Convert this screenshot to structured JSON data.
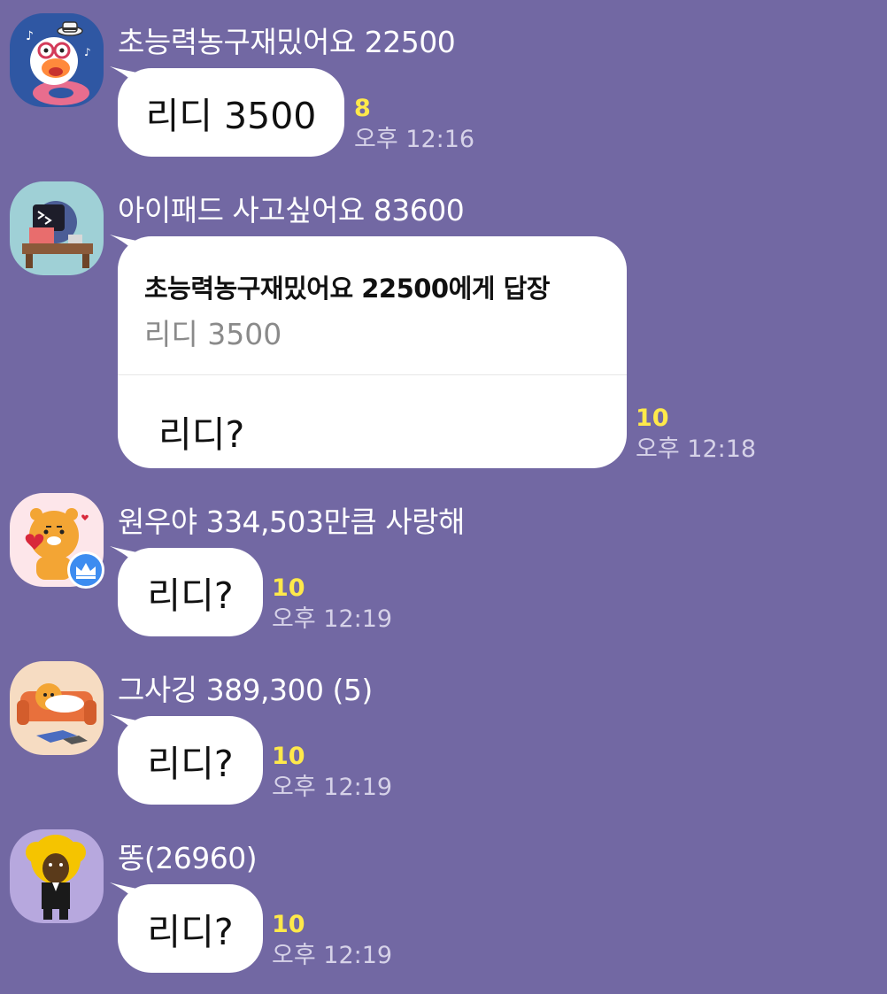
{
  "accent_colors": {
    "background": "#7268a3",
    "bubble": "#ffffff",
    "unread_count": "#ffe94a",
    "time": "#d6d2e8"
  },
  "messages": [
    {
      "sender": "초능력농구재밌어요 22500",
      "avatar_icon": "duck-character-icon",
      "text": "리디 3500",
      "unread": "8",
      "time": "오후 12:16"
    },
    {
      "sender": "아이패드 사고싶어요 83600",
      "avatar_icon": "bear-at-desk-character-icon",
      "reply": {
        "title": "초능력농구재밌어요 22500에게 답장",
        "quote": "리디 3500"
      },
      "text": "리디?",
      "unread": "10",
      "time": "오후 12:18"
    },
    {
      "sender": "원우야 334,503만큼 사랑해",
      "avatar_icon": "lion-heart-character-icon",
      "badge_icon": "crown-icon",
      "text": "리디?",
      "unread": "10",
      "time": "오후 12:19"
    },
    {
      "sender": "그사깅 389,300 (5)",
      "avatar_icon": "lion-on-sofa-character-icon",
      "text": "리디?",
      "unread": "10",
      "time": "오후 12:19"
    },
    {
      "sender": "똥(26960)",
      "avatar_icon": "afro-character-icon",
      "text": "리디?",
      "unread": "10",
      "time": "오후 12:19"
    }
  ]
}
